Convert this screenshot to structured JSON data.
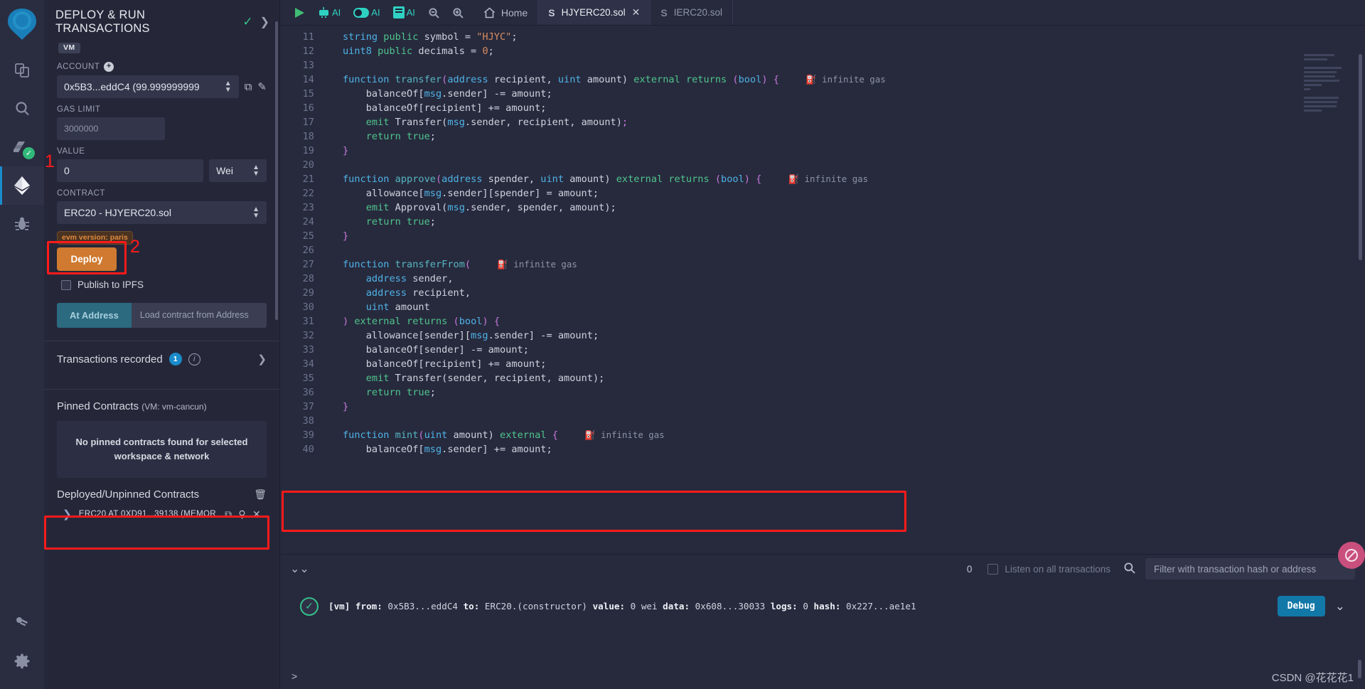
{
  "rail": {
    "items": [
      {
        "name": "remix-logo",
        "label": "Remix"
      },
      {
        "name": "file-explorer",
        "label": "File explorer"
      },
      {
        "name": "search",
        "label": "Search in files"
      },
      {
        "name": "solidity-compiler",
        "label": "Solidity compiler"
      },
      {
        "name": "deploy-run",
        "label": "Deploy & run transactions"
      },
      {
        "name": "debugger",
        "label": "Debugger"
      },
      {
        "name": "plugin-manager",
        "label": "Plugin manager"
      },
      {
        "name": "settings",
        "label": "Settings"
      }
    ]
  },
  "panel": {
    "title": "DEPLOY & RUN TRANSACTIONS",
    "env_tag": "VM",
    "account_label": "ACCOUNT",
    "account_value": "0x5B3...eddC4 (99.999999999",
    "gas_label": "GAS LIMIT",
    "gas_value": "3000000",
    "value_label": "VALUE",
    "value_value": "0",
    "value_unit": "Wei",
    "contract_label": "CONTRACT",
    "contract_value": "ERC20 - HJYERC20.sol",
    "evm_version": "evm version: paris",
    "deploy_label": "Deploy",
    "publish_ipfs_label": "Publish to IPFS",
    "at_address_label": "At Address",
    "at_address_placeholder": "Load contract from Address",
    "transactions_recorded_label": "Transactions recorded",
    "transactions_recorded_count": "1",
    "pinned_title": "Pinned Contracts",
    "pinned_sub": "(VM: vm-cancun)",
    "pinned_empty": "No pinned contracts found for selected workspace & network",
    "deployed_title": "Deployed/Unpinned Contracts",
    "deployed_item": "ERC20 AT 0XD91...39138 (MEMOR",
    "callout_1": "1",
    "callout_2": "2"
  },
  "toolbar": {
    "run_label": "run-script",
    "ai_label": "AI",
    "home_label": "Home",
    "tabs": [
      {
        "label": "HJYERC20.sol",
        "active": true,
        "closable": true
      },
      {
        "label": "IERC20.sol",
        "active": false,
        "closable": false
      }
    ]
  },
  "editor": {
    "gas_annotation": "infinite gas",
    "lines": [
      {
        "n": "11",
        "segs": [
          {
            "t": "string",
            "c": "kw"
          },
          {
            "t": " ",
            "c": ""
          },
          {
            "t": "public",
            "c": "kw2"
          },
          {
            "t": " symbol = ",
            "c": ""
          },
          {
            "t": "\"HJYC\"",
            "c": "str"
          },
          {
            "t": ";",
            "c": ""
          }
        ]
      },
      {
        "n": "12",
        "segs": [
          {
            "t": "uint8",
            "c": "kw"
          },
          {
            "t": " ",
            "c": ""
          },
          {
            "t": "public",
            "c": "kw2"
          },
          {
            "t": " decimals = ",
            "c": ""
          },
          {
            "t": "0",
            "c": "num"
          },
          {
            "t": ";",
            "c": ""
          }
        ]
      },
      {
        "n": "13",
        "segs": []
      },
      {
        "n": "14",
        "segs": [
          {
            "t": "function ",
            "c": "kw"
          },
          {
            "t": "transfer",
            "c": "fn"
          },
          {
            "t": "(",
            "c": "typ"
          },
          {
            "t": "address",
            "c": "kw"
          },
          {
            "t": " recipient, ",
            "c": ""
          },
          {
            "t": "uint",
            "c": "kw"
          },
          {
            "t": " amount) ",
            "c": ""
          },
          {
            "t": "external returns ",
            "c": "kw2"
          },
          {
            "t": "(",
            "c": "typ"
          },
          {
            "t": "bool",
            "c": "kw"
          },
          {
            "t": ") {",
            "c": "typ"
          }
        ],
        "gas": true
      },
      {
        "n": "15",
        "segs": [
          {
            "t": "    balanceOf[",
            "c": ""
          },
          {
            "t": "msg",
            "c": "mem"
          },
          {
            "t": ".sender] -= amount;",
            "c": ""
          }
        ]
      },
      {
        "n": "16",
        "segs": [
          {
            "t": "    balanceOf[recipient] += amount;",
            "c": ""
          }
        ]
      },
      {
        "n": "17",
        "segs": [
          {
            "t": "    ",
            "c": ""
          },
          {
            "t": "emit",
            "c": "kw2"
          },
          {
            "t": " Transfer(",
            "c": ""
          },
          {
            "t": "msg",
            "c": "mem"
          },
          {
            "t": ".sender, recipient, amount)",
            "c": ""
          },
          {
            "t": ";",
            "c": "typ"
          }
        ]
      },
      {
        "n": "18",
        "segs": [
          {
            "t": "    ",
            "c": ""
          },
          {
            "t": "return",
            "c": "kw2"
          },
          {
            "t": " ",
            "c": ""
          },
          {
            "t": "true",
            "c": "kw2"
          },
          {
            "t": ";",
            "c": ""
          }
        ]
      },
      {
        "n": "19",
        "segs": [
          {
            "t": "}",
            "c": "typ"
          }
        ]
      },
      {
        "n": "20",
        "segs": []
      },
      {
        "n": "21",
        "segs": [
          {
            "t": "function ",
            "c": "kw"
          },
          {
            "t": "approve",
            "c": "fn"
          },
          {
            "t": "(",
            "c": "typ"
          },
          {
            "t": "address",
            "c": "kw"
          },
          {
            "t": " spender, ",
            "c": ""
          },
          {
            "t": "uint",
            "c": "kw"
          },
          {
            "t": " amount) ",
            "c": ""
          },
          {
            "t": "external returns ",
            "c": "kw2"
          },
          {
            "t": "(",
            "c": "typ"
          },
          {
            "t": "bool",
            "c": "kw"
          },
          {
            "t": ") {",
            "c": "typ"
          }
        ],
        "gas": true
      },
      {
        "n": "22",
        "segs": [
          {
            "t": "    allowance[",
            "c": ""
          },
          {
            "t": "msg",
            "c": "mem"
          },
          {
            "t": ".sender][spender] = amount;",
            "c": ""
          }
        ]
      },
      {
        "n": "23",
        "segs": [
          {
            "t": "    ",
            "c": ""
          },
          {
            "t": "emit",
            "c": "kw2"
          },
          {
            "t": " Approval(",
            "c": ""
          },
          {
            "t": "msg",
            "c": "mem"
          },
          {
            "t": ".sender, spender, amount);",
            "c": ""
          }
        ]
      },
      {
        "n": "24",
        "segs": [
          {
            "t": "    ",
            "c": ""
          },
          {
            "t": "return",
            "c": "kw2"
          },
          {
            "t": " ",
            "c": ""
          },
          {
            "t": "true",
            "c": "kw2"
          },
          {
            "t": ";",
            "c": ""
          }
        ]
      },
      {
        "n": "25",
        "segs": [
          {
            "t": "}",
            "c": "typ"
          }
        ]
      },
      {
        "n": "26",
        "segs": []
      },
      {
        "n": "27",
        "segs": [
          {
            "t": "function ",
            "c": "kw"
          },
          {
            "t": "transferFrom",
            "c": "fn"
          },
          {
            "t": "(",
            "c": "typ"
          }
        ],
        "gas": true
      },
      {
        "n": "28",
        "segs": [
          {
            "t": "    ",
            "c": ""
          },
          {
            "t": "address",
            "c": "kw"
          },
          {
            "t": " sender,",
            "c": ""
          }
        ]
      },
      {
        "n": "29",
        "segs": [
          {
            "t": "    ",
            "c": ""
          },
          {
            "t": "address",
            "c": "kw"
          },
          {
            "t": " recipient,",
            "c": ""
          }
        ]
      },
      {
        "n": "30",
        "segs": [
          {
            "t": "    ",
            "c": ""
          },
          {
            "t": "uint",
            "c": "kw"
          },
          {
            "t": " amount",
            "c": ""
          }
        ]
      },
      {
        "n": "31",
        "segs": [
          {
            "t": ")",
            "c": "typ"
          },
          {
            "t": " ",
            "c": ""
          },
          {
            "t": "external returns ",
            "c": "kw2"
          },
          {
            "t": "(",
            "c": "typ"
          },
          {
            "t": "bool",
            "c": "kw"
          },
          {
            "t": ") {",
            "c": "typ"
          }
        ]
      },
      {
        "n": "32",
        "segs": [
          {
            "t": "    allowance[sender][",
            "c": ""
          },
          {
            "t": "msg",
            "c": "mem"
          },
          {
            "t": ".sender] -= amount;",
            "c": ""
          }
        ]
      },
      {
        "n": "33",
        "segs": [
          {
            "t": "    balanceOf[sender] -= amount;",
            "c": ""
          }
        ]
      },
      {
        "n": "34",
        "segs": [
          {
            "t": "    balanceOf[recipient] += amount;",
            "c": ""
          }
        ]
      },
      {
        "n": "35",
        "segs": [
          {
            "t": "    ",
            "c": ""
          },
          {
            "t": "emit",
            "c": "kw2"
          },
          {
            "t": " Transfer(sender, recipient, amount);",
            "c": ""
          }
        ]
      },
      {
        "n": "36",
        "segs": [
          {
            "t": "    ",
            "c": ""
          },
          {
            "t": "return",
            "c": "kw2"
          },
          {
            "t": " ",
            "c": ""
          },
          {
            "t": "true",
            "c": "kw2"
          },
          {
            "t": ";",
            "c": ""
          }
        ]
      },
      {
        "n": "37",
        "segs": [
          {
            "t": "}",
            "c": "typ"
          }
        ]
      },
      {
        "n": "38",
        "segs": []
      },
      {
        "n": "39",
        "segs": [
          {
            "t": "function ",
            "c": "kw"
          },
          {
            "t": "mint",
            "c": "fn"
          },
          {
            "t": "(",
            "c": "typ"
          },
          {
            "t": "uint",
            "c": "kw"
          },
          {
            "t": " amount) ",
            "c": ""
          },
          {
            "t": "external",
            "c": "kw2"
          },
          {
            "t": " {",
            "c": "typ"
          }
        ],
        "gas": true
      },
      {
        "n": "40",
        "segs": [
          {
            "t": "    balanceOf[",
            "c": ""
          },
          {
            "t": "msg",
            "c": "mem"
          },
          {
            "t": ".sender] += amount;",
            "c": ""
          }
        ]
      }
    ]
  },
  "terminal": {
    "count": "0",
    "listen_label": "Listen on all transactions",
    "filter_placeholder": "Filter with transaction hash or address",
    "tx_text": "[vm] from: 0x5B3...eddC4 to: ERC20.(constructor) value: 0 wei data: 0x608...30033 logs: 0 hash: 0x227...ae1e1",
    "tx_parts": [
      {
        "t": "[vm]",
        "b": true
      },
      {
        "t": "from:",
        "b": true
      },
      {
        "t": "0x5B3...eddC4",
        "b": false
      },
      {
        "t": "to:",
        "b": true
      },
      {
        "t": "ERC20.(constructor)",
        "b": false
      },
      {
        "t": "value:",
        "b": true
      },
      {
        "t": "0 wei",
        "b": false
      },
      {
        "t": "data:",
        "b": true
      },
      {
        "t": "0x608...30033",
        "b": false
      },
      {
        "t": "logs:",
        "b": true
      },
      {
        "t": "0",
        "b": false
      },
      {
        "t": "hash:",
        "b": true
      },
      {
        "t": "0x227...ae1e1",
        "b": false
      }
    ],
    "debug_label": "Debug",
    "prompt": ">",
    "watermark": "CSDN @花花花1"
  },
  "colors": {
    "accent_orange": "#cf7a30",
    "accent_blue": "#1278a8",
    "highlight_red": "#ff1a1a",
    "success_green": "#35c08a"
  }
}
